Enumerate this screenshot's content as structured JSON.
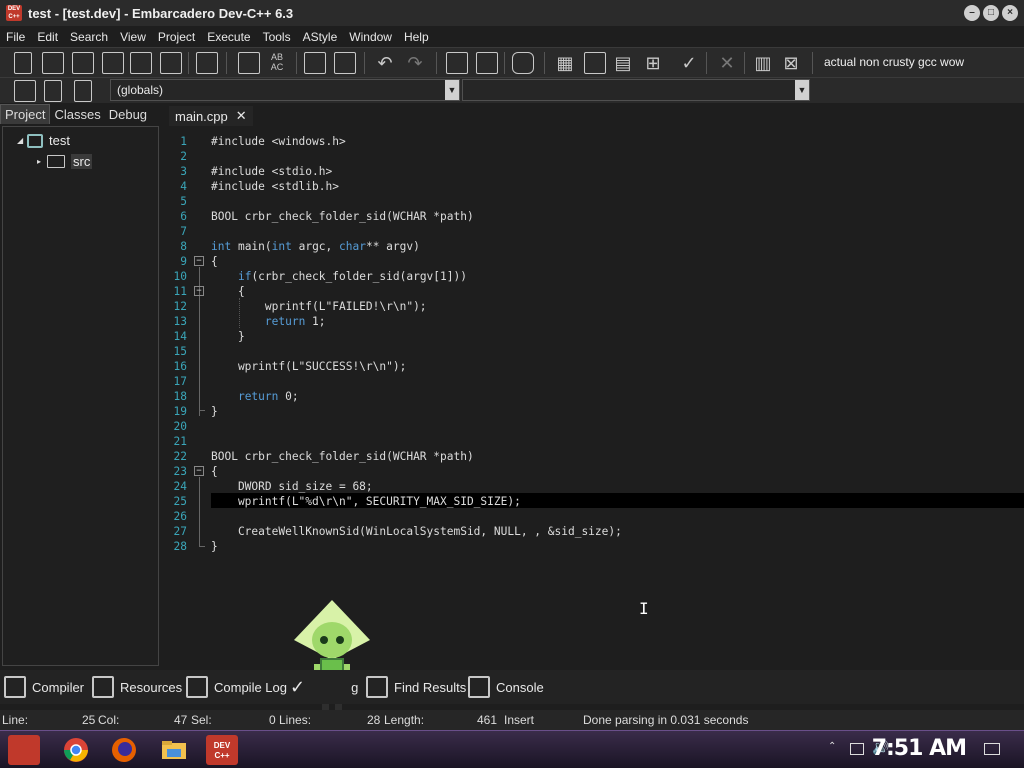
{
  "window": {
    "title": "test - [test.dev] - Embarcadero Dev-C++ 6.3",
    "icon_text": "DEV C++"
  },
  "menu": [
    "File",
    "Edit",
    "Search",
    "View",
    "Project",
    "Execute",
    "Tools",
    "AStyle",
    "Window",
    "Help"
  ],
  "toolbar": {
    "compiler_set": "actual non crusty gcc wow",
    "scope_combo": "(globals)",
    "function_combo": ""
  },
  "left_panel": {
    "tabs": [
      "Project",
      "Classes",
      "Debug"
    ],
    "active_tab": "Project",
    "tree": {
      "project": "test",
      "folder": "src"
    }
  },
  "editor": {
    "tab_label": "main.cpp",
    "tab_close": "✕",
    "highlighted_line": 25,
    "lines": [
      "#include <windows.h>",
      "",
      "#include <stdio.h>",
      "#include <stdlib.h>",
      "",
      "BOOL crbr_check_folder_sid(WCHAR *path)",
      "",
      "int main(int argc, char** argv)",
      "{",
      "    if(crbr_check_folder_sid(argv[1]))",
      "    {",
      "        wprintf(L\"FAILED!\\r\\n\");",
      "        return 1;",
      "    }",
      "",
      "    wprintf(L\"SUCCESS!\\r\\n\");",
      "",
      "    return 0;",
      "}",
      "",
      "",
      "BOOL crbr_check_folder_sid(WCHAR *path)",
      "{",
      "    DWORD sid_size = 68;",
      "    wprintf(L\"%d\\r\\n\", SECURITY_MAX_SID_SIZE);",
      "",
      "    CreateWellKnownSid(WinLocalSystemSid, NULL, , &sid_size);",
      "}"
    ]
  },
  "bottom_tabs": [
    "Compiler",
    "Resources",
    "Compile Log",
    "Debug",
    "Find Results",
    "Console"
  ],
  "bottom_tab_debug_visible": "g",
  "status": {
    "line_label": "Line:",
    "line_value": "25",
    "col_label": "Col:",
    "col_value": "47",
    "sel_label": "Sel:",
    "sel_value": "0",
    "lines_label": "Lines:",
    "lines_value": "28",
    "length_label": "Length:",
    "length_value": "461",
    "mode": "Insert",
    "message": "Done parsing in 0.031 seconds"
  },
  "taskbar": {
    "clock": "7:51 AM",
    "dev_icon": "DEV C++"
  }
}
